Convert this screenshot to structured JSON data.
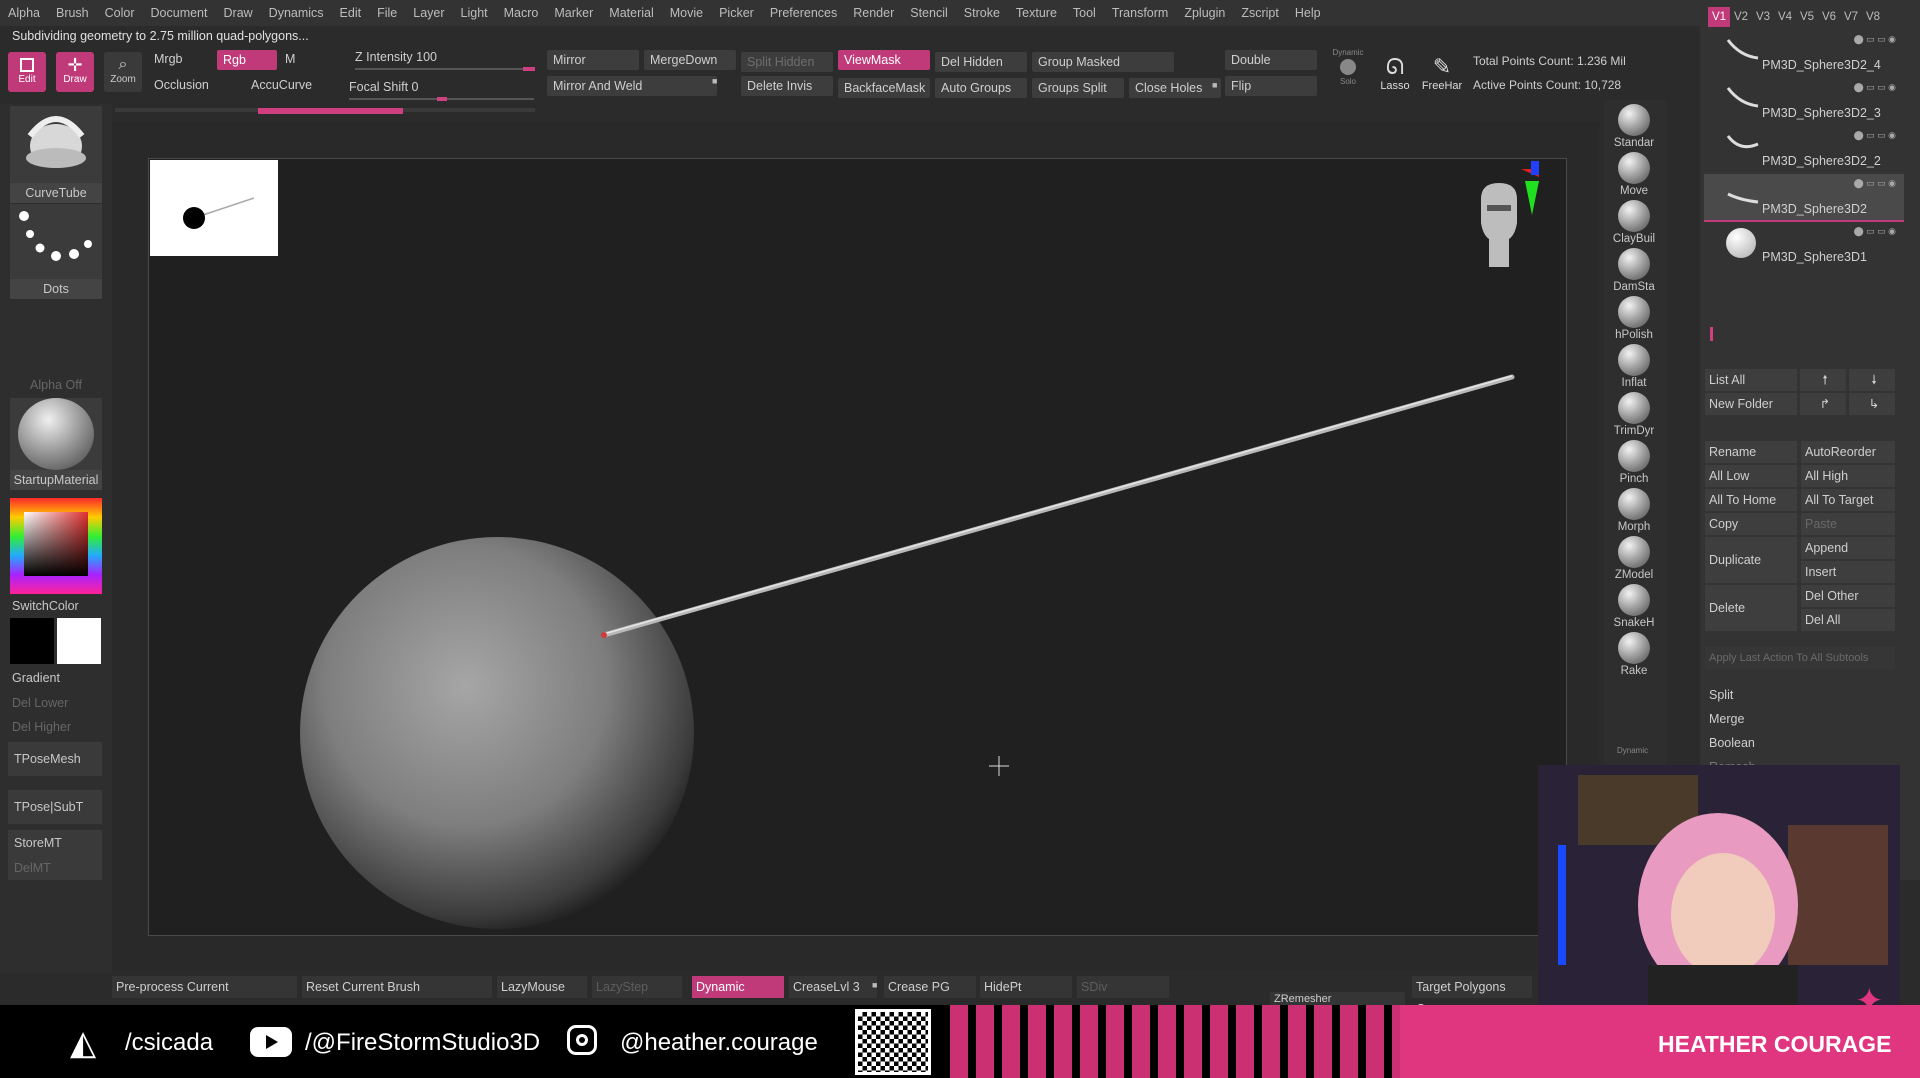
{
  "menu": [
    "Alpha",
    "Brush",
    "Color",
    "Document",
    "Draw",
    "Dynamics",
    "Edit",
    "File",
    "Layer",
    "Light",
    "Macro",
    "Marker",
    "Material",
    "Movie",
    "Picker",
    "Preferences",
    "Render",
    "Stencil",
    "Stroke",
    "Texture",
    "Tool",
    "Transform",
    "Zplugin",
    "Zscript",
    "Help"
  ],
  "status_message": "Subdividing geometry to 2.75 million quad-polygons...",
  "toolbar": {
    "edit_label": "Edit",
    "draw_label": "Draw",
    "zoom_label": "Zoom",
    "mrgb": "Mrgb",
    "rgb": "Rgb",
    "m": "M",
    "occlusion": "Occlusion",
    "accucurve": "AccuCurve",
    "z_intensity_label": "Z Intensity",
    "z_intensity_value": "100",
    "focal_shift_label": "Focal Shift",
    "focal_shift_value": "0",
    "mirror": "Mirror",
    "mergedown": "MergeDown",
    "split_hidden": "Split Hidden",
    "viewmask": "ViewMask",
    "del_hidden": "Del Hidden",
    "group_masked": "Group Masked",
    "double": "Double",
    "mirror_and_weld": "Mirror And Weld",
    "delete_invis": "Delete Invis",
    "backfacemask": "BackfaceMask",
    "auto_groups": "Auto Groups",
    "groups_split": "Groups Split",
    "close_holes": "Close Holes",
    "flip": "Flip",
    "dynamic_solo_label": "Dynamic",
    "solo_label": "Solo",
    "lasso": "Lasso",
    "freehand": "FreeHar",
    "total_points": "Total Points Count: 1.236 Mil",
    "active_points": "Active Points Count: 10,728"
  },
  "left_panel": {
    "brush_name": "CurveTube",
    "stroke_name": "Dots",
    "alpha_label": "Alpha Off",
    "material_name": "StartupMaterial",
    "switch_color": "SwitchColor",
    "gradient": "Gradient",
    "del_lower": "Del Lower",
    "del_higher": "Del Higher",
    "tposemesh": "TPoseMesh",
    "tpose_subt": "TPose|SubT",
    "storemt": "StoreMT",
    "delmt": "DelMT"
  },
  "brushes": [
    "Standar",
    "Move",
    "ClayBuil",
    "DamSta",
    "hPolish",
    "Inflat",
    "TrimDyr",
    "Pinch",
    "Morph",
    "ZModel",
    "SnakeH",
    "Rake"
  ],
  "subtool": {
    "version_tabs": [
      "V1",
      "V2",
      "V3",
      "V4",
      "V5",
      "V6",
      "V7",
      "V8"
    ],
    "items": [
      "PM3D_Sphere3D2_4",
      "PM3D_Sphere3D2_3",
      "PM3D_Sphere3D2_2",
      "PM3D_Sphere3D2",
      "PM3D_Sphere3D1"
    ],
    "list_all": "List All",
    "new_folder": "New Folder",
    "rename": "Rename",
    "autoreorder": "AutoReorder",
    "all_low": "All Low",
    "all_high": "All High",
    "all_to_home": "All To Home",
    "all_to_target": "All To Target",
    "copy": "Copy",
    "paste": "Paste",
    "duplicate": "Duplicate",
    "append": "Append",
    "insert": "Insert",
    "delete": "Delete",
    "del_other": "Del Other",
    "del_all": "Del All",
    "apply_last": "Apply Last Action To All Subtools",
    "split": "Split",
    "merge": "Merge",
    "boolean": "Boolean",
    "remesh_partial": "Remesh"
  },
  "bottom": {
    "preprocess": "Pre-process Current",
    "reset_brush": "Reset Current Brush",
    "lazymouse": "LazyMouse",
    "lazystep": "LazyStep",
    "dynamic": "Dynamic",
    "creaselvl": "CreaseLvl 3",
    "crease_pg": "Crease PG",
    "hidept": "HidePt",
    "sdiv": "SDiv",
    "zremesher": "ZRemesher",
    "target_polygons": "Target Polygons Cour"
  },
  "dynamic_label_right": "Dynamic",
  "footer": {
    "handle_1": "/csicada",
    "handle_2": "/@FireStormStudio3D",
    "handle_3": "@heather.courage",
    "brand": "HEATHER COURAGE"
  },
  "colors": {
    "accent": "#c03a7a",
    "footer_pink": "#e0357f"
  }
}
